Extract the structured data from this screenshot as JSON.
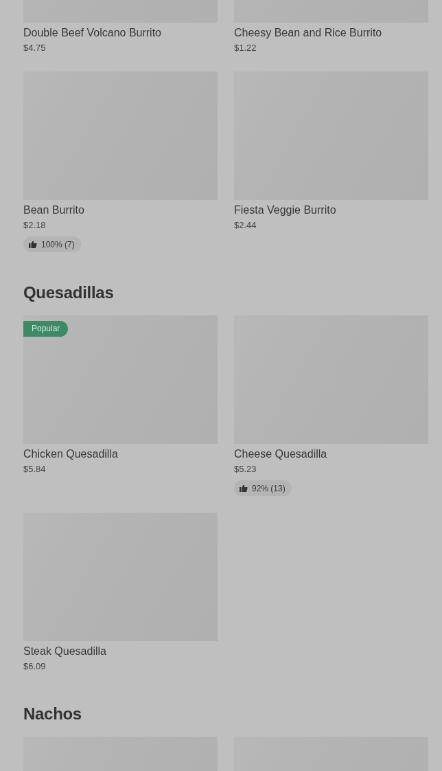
{
  "popular_label": "Popular",
  "sections": [
    {
      "items": [
        {
          "name": "Double Beef Volcano Burrito",
          "price": "$4.75"
        },
        {
          "name": "Cheesy Bean and Rice Burrito",
          "price": "$1.22"
        },
        {
          "name": "Bean Burrito",
          "price": "$2.18",
          "rating": "100% (7)",
          "popular": false
        },
        {
          "name": "Fiesta Veggie Burrito",
          "price": "$2.44",
          "popular": false
        }
      ]
    },
    {
      "title": "Quesadillas",
      "items": [
        {
          "name": "Chicken Quesadilla",
          "price": "$5.84",
          "popular": true
        },
        {
          "name": "Cheese Quesadilla",
          "price": "$5.23",
          "rating": "92% (13)",
          "popular": false
        },
        {
          "name": "Steak Quesadilla",
          "price": "$6.09",
          "popular": false
        }
      ]
    },
    {
      "title": "Nachos",
      "items": [
        {
          "popular": false
        },
        {
          "popular": false
        }
      ]
    }
  ]
}
